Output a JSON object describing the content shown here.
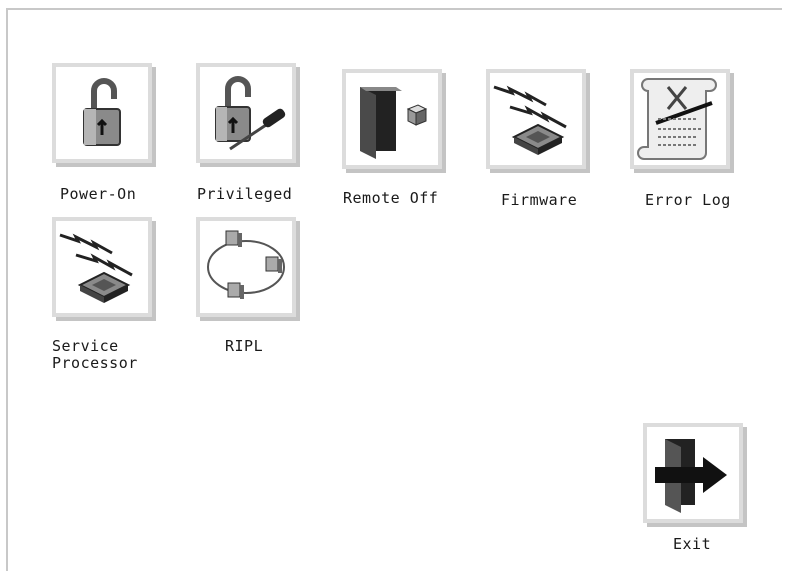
{
  "menu": {
    "items": [
      {
        "id": "power-on",
        "label": "Power-On"
      },
      {
        "id": "privileged",
        "label": "Privileged"
      },
      {
        "id": "remote-off",
        "label": "Remote Off"
      },
      {
        "id": "firmware",
        "label": "Firmware"
      },
      {
        "id": "error-log",
        "label": "Error Log"
      },
      {
        "id": "service-processor",
        "label_line1": "Service",
        "label_line2": "Processor"
      },
      {
        "id": "ripl",
        "label": "RIPL"
      }
    ],
    "exit": {
      "label": "Exit"
    }
  },
  "icons": {
    "power-on": "padlock-icon",
    "privileged": "padlock-screwdriver-icon",
    "remote-off": "door-icon",
    "firmware": "chip-lightning-icon",
    "error-log": "scroll-document-icon",
    "service-processor": "chip-lightning-icon",
    "ripl": "network-ring-icon",
    "exit": "door-exit-arrow-icon"
  }
}
